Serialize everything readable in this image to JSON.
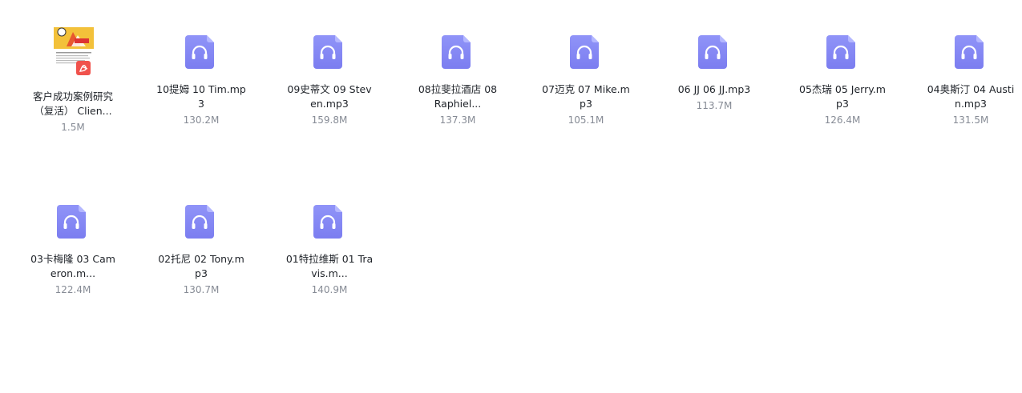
{
  "colors": {
    "audio_icon_top": "#8b8ff7",
    "audio_icon_bottom": "#7c7ef0",
    "name_text": "#1f2329",
    "size_text": "#868b95",
    "pdf_badge": "#f0524c"
  },
  "files": [
    {
      "icon": "pdf-thumbnail-icon",
      "name": "客户成功案例研究\n（复活） Clien...",
      "size": "1.5M"
    },
    {
      "icon": "audio-file-icon",
      "name": "10提姆 10 Tim.mp\n3",
      "size": "130.2M"
    },
    {
      "icon": "audio-file-icon",
      "name": "09史蒂文 09 Stev\nen.mp3",
      "size": "159.8M"
    },
    {
      "icon": "audio-file-icon",
      "name": "08拉斐拉酒店 08\nRaphiel...",
      "size": "137.3M"
    },
    {
      "icon": "audio-file-icon",
      "name": "07迈克 07 Mike.m\np3",
      "size": "105.1M"
    },
    {
      "icon": "audio-file-icon",
      "name": "06 JJ 06 JJ.mp3",
      "size": "113.7M"
    },
    {
      "icon": "audio-file-icon",
      "name": "05杰瑞 05 Jerry.m\np3",
      "size": "126.4M"
    },
    {
      "icon": "audio-file-icon",
      "name": "04奥斯汀 04 Austi\nn.mp3",
      "size": "131.5M"
    },
    {
      "icon": "audio-file-icon",
      "name": "03卡梅隆 03 Cam\neron.m...",
      "size": "122.4M"
    },
    {
      "icon": "audio-file-icon",
      "name": "02托尼 02 Tony.m\np3",
      "size": "130.7M"
    },
    {
      "icon": "audio-file-icon",
      "name": "01特拉维斯 01 Tra\nvis.m...",
      "size": "140.9M"
    }
  ]
}
